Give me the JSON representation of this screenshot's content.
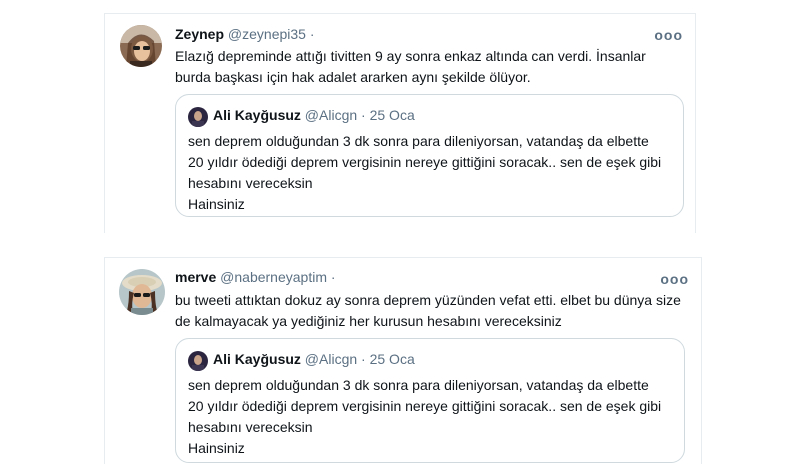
{
  "tweets": [
    {
      "author_name": "Zeynep",
      "author_handle": "@zeynepi35",
      "separator": "·",
      "more_label": "ooo",
      "text": "Elazığ depreminde attığı tivitten 9 ay sonra enkaz altında can verdi. İnsanlar burda başkası için hak adalet ararken aynı şekilde ölüyor.",
      "quote": {
        "author_name": "Ali Kayğusuz",
        "author_handle": "@Alicgn",
        "separator": "·",
        "date": "25 Oca",
        "text": "sen deprem olduğundan 3 dk sonra para dileniyorsan, vatandaş da elbette 20 yıldır ödediği deprem vergisinin nereye gittiğini soracak.. sen de eşek gibi hesabını vereceksin",
        "text2": "Hainsiniz"
      }
    },
    {
      "author_name": "merve",
      "author_handle": "@naberneyaptim",
      "separator": "·",
      "more_label": "ooo",
      "text": "bu tweeti attıktan dokuz ay sonra deprem yüzünden vefat etti. elbet bu dünya size de kalmayacak ya yediğiniz her kurusun hesabını vereceksiniz",
      "quote": {
        "author_name": "Ali Kayğusuz",
        "author_handle": "@Alicgn",
        "separator": "·",
        "date": "25 Oca",
        "text": "sen deprem olduğundan 3 dk sonra para dileniyorsan, vatandaş da elbette 20 yıldır ödediği deprem vergisinin nereye gittiğini soracak.. sen de eşek gibi hesabını vereceksin",
        "text2": "Hainsiniz"
      }
    }
  ]
}
